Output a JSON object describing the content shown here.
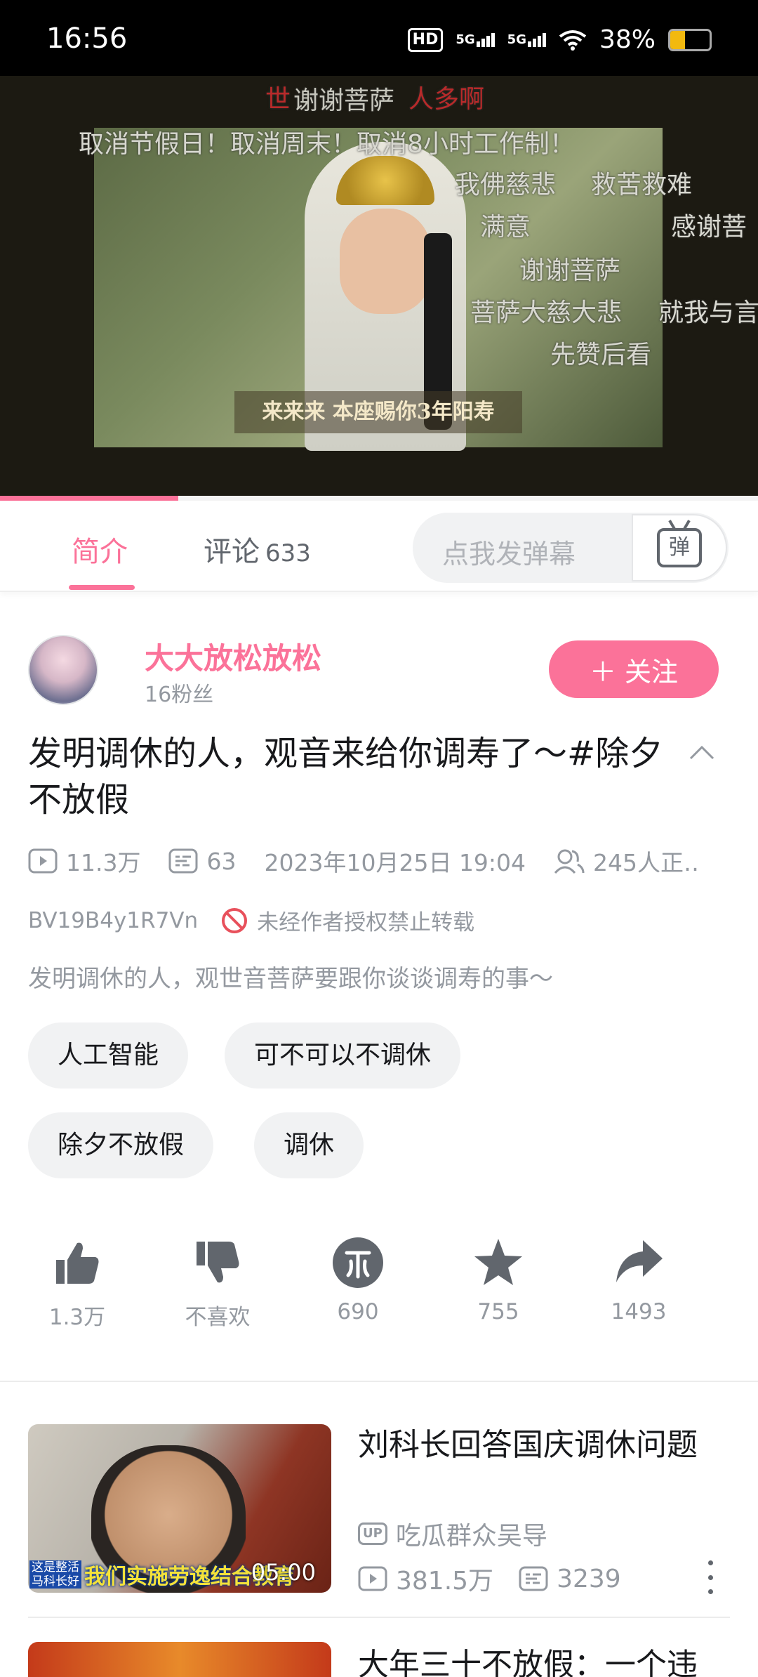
{
  "status_bar": {
    "time": "16:56",
    "hd_badge": "HD",
    "signal1": "5G",
    "signal2": "5G",
    "battery_text": "38%",
    "battery_level": 0.38
  },
  "video": {
    "subtitle": "来来来 本座赐你3年阳寿",
    "playback_progress": 0.235,
    "danmaku": [
      "世",
      "谢谢菩萨",
      "人多啊",
      "取消节假日！取消周末！取消8小时工作制！",
      "我佛慈悲",
      "救苦救难",
      "满意",
      "感谢菩",
      "谢谢菩萨",
      "菩萨大慈大悲",
      "就我与言",
      "先赞后看"
    ]
  },
  "tabs": {
    "intro": "简介",
    "comments": "评论",
    "comments_count": "633",
    "danmaku_placeholder": "点我发弹幕",
    "danmaku_button": "弹"
  },
  "uploader": {
    "name": "大大放松放松",
    "fans": "16粉丝",
    "follow_label": "＋ 关注"
  },
  "video_info": {
    "title": "发明调休的人，观音来给你调寿了～#除夕不放假",
    "views": "11.3万",
    "danmaku_count": "63",
    "datetime": "2023年10月25日 19:04",
    "watching": "245人正‥",
    "bvid": "BV19B4y1R7Vn",
    "copyright": "未经作者授权禁止转载",
    "description": "发明调休的人，观世音菩萨要跟你谈谈调寿的事～",
    "tags": [
      "人工智能",
      "可不可以不调休",
      "除夕不放假",
      "调休"
    ]
  },
  "actions": {
    "like": "1.3万",
    "dislike": "不喜欢",
    "coin": "690",
    "favorite": "755",
    "share": "1493"
  },
  "recommendations": [
    {
      "title": "刘科长回答国庆调休问题",
      "duration": "05:00",
      "thumb_caption": "我们实施劳逸结合教育",
      "thumb_caption_left": "这是整活\n马科长好",
      "up_badge": "UP",
      "uploader": "吃瓜群众吴导",
      "views": "381.5万",
      "danmaku": "3239"
    },
    {
      "title": "大年三十不放假：一个违"
    }
  ]
}
